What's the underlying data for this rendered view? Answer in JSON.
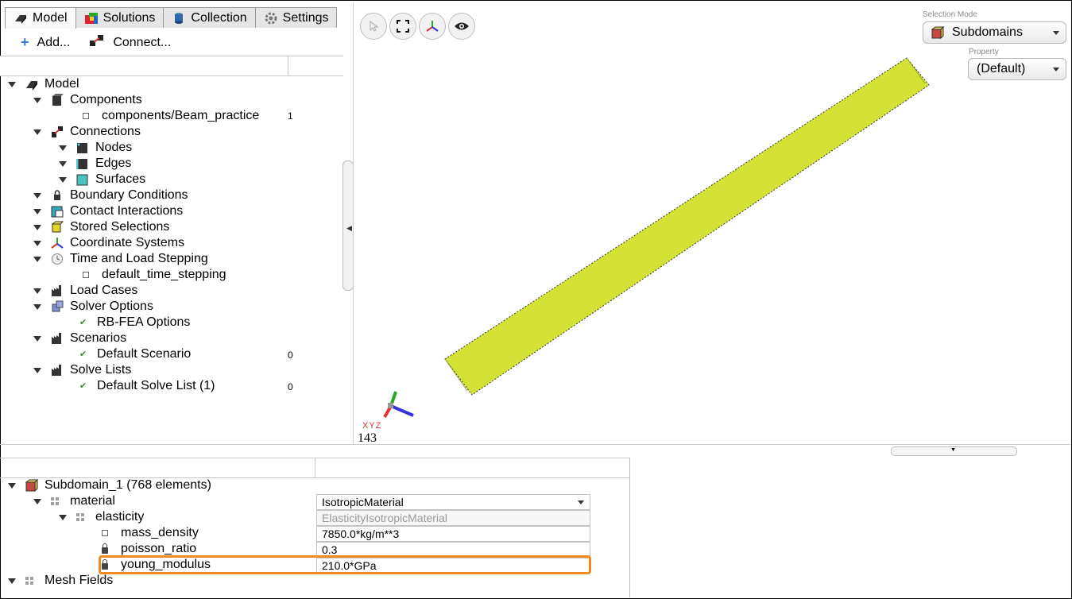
{
  "tabs": [
    {
      "label": "Model",
      "icon": "model-icon",
      "active": true
    },
    {
      "label": "Solutions",
      "icon": "solutions-icon"
    },
    {
      "label": "Collection",
      "icon": "collection-icon"
    },
    {
      "label": "Settings",
      "icon": "gear-icon"
    }
  ],
  "toolbar": {
    "add_label": "Add...",
    "connect_label": "Connect..."
  },
  "tree": {
    "model": "Model",
    "components": "Components",
    "component_item": "components/Beam_practice",
    "component_item_count": "1",
    "connections": "Connections",
    "nodes": "Nodes",
    "edges": "Edges",
    "surfaces": "Surfaces",
    "boundary_conditions": "Boundary Conditions",
    "contact_interactions": "Contact Interactions",
    "stored_selections": "Stored Selections",
    "coordinate_systems": "Coordinate Systems",
    "time_load_stepping": "Time and Load Stepping",
    "default_time_stepping": "default_time_stepping",
    "load_cases": "Load Cases",
    "solver_options": "Solver Options",
    "rbfea_options": "RB-FEA Options",
    "scenarios": "Scenarios",
    "default_scenario": "Default Scenario",
    "default_scenario_count": "0",
    "solve_lists": "Solve Lists",
    "default_solve_list": "Default Solve List (1)",
    "default_solve_list_count": "0"
  },
  "viewport": {
    "selection_mode_label": "Selection Mode",
    "selection_mode_value": "Subdomains",
    "property_label": "Property",
    "property_value": "(Default)",
    "axis_labels": "XYZ",
    "axis_number": "143",
    "beam_color": "#d4e236"
  },
  "properties": {
    "subdomain": "Subdomain_1 (768 elements)",
    "material_label": "material",
    "material_value": "IsotropicMaterial",
    "elasticity_label": "elasticity",
    "elasticity_value": "ElasticityIsotropicMaterial",
    "mass_density_label": "mass_density",
    "mass_density_value": "7850.0*kg/m**3",
    "poisson_ratio_label": "poisson_ratio",
    "poisson_ratio_value": "0.3",
    "young_modulus_label": "young_modulus",
    "young_modulus_value": "210.0*GPa",
    "mesh_fields_label": "Mesh Fields"
  },
  "colors": {
    "highlight": "#f08a1c",
    "accent_green": "#3a8a3a"
  }
}
